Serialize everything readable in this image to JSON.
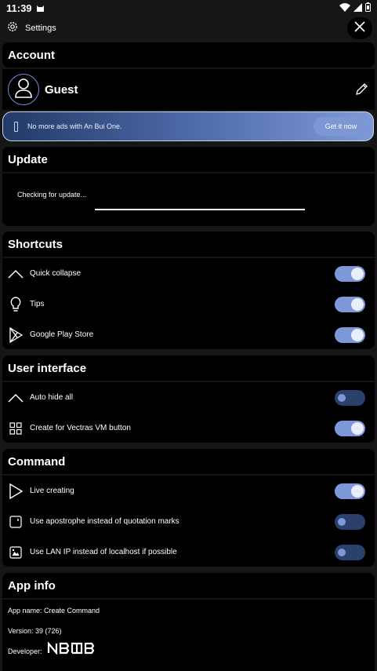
{
  "status_bar": {
    "time": "11:39"
  },
  "top_bar": {
    "title": "Settings"
  },
  "account": {
    "header": "Account",
    "user_name": "Guest",
    "banner_text": "No more ads with An Bui One.",
    "banner_button": "Get it now"
  },
  "update": {
    "header": "Update",
    "status_text": "Checking for update..."
  },
  "shortcuts": {
    "header": "Shortcuts",
    "items": [
      {
        "label": "Quick collapse",
        "icon": "chevron-up-icon",
        "on": true
      },
      {
        "label": "Tips",
        "icon": "lightbulb-icon",
        "on": true
      },
      {
        "label": "Google Play Store",
        "icon": "play-store-icon",
        "on": true
      }
    ]
  },
  "user_interface": {
    "header": "User interface",
    "items": [
      {
        "label": "Auto hide all",
        "icon": "chevron-up-icon",
        "on": false
      },
      {
        "label": "Create for Vectras VM button",
        "icon": "grid-icon",
        "on": true
      }
    ]
  },
  "command": {
    "header": "Command",
    "items": [
      {
        "label": "Live creating",
        "icon": "play-icon",
        "on": true
      },
      {
        "label": "Use apostrophe instead of quotation marks",
        "icon": "quote-box-icon",
        "on": false
      },
      {
        "label": "Use LAN IP instead of localhost if possible",
        "icon": "network-box-icon",
        "on": false
      }
    ]
  },
  "app_info": {
    "header": "App info",
    "app_name": "App name: Create Command",
    "version": "Version: 39 (726)",
    "developer_label": "Developer:",
    "developer_logo": "NBOB"
  },
  "colors": {
    "background": "#161616",
    "card": "#000000",
    "accent": "#7d98d8",
    "toggle_off": "#2c406c"
  }
}
